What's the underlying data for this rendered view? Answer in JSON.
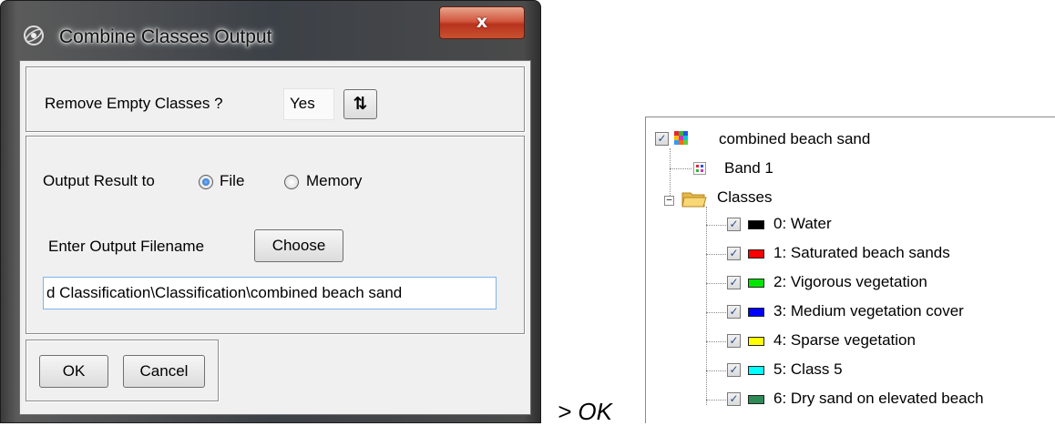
{
  "dialog": {
    "title": "Combine Classes Output",
    "close_label": "x",
    "remove_empty_label": "Remove Empty Classes ?",
    "remove_empty_value": "Yes",
    "output_label": "Output Result to",
    "radio_file_label": "File",
    "radio_memory_label": "Memory",
    "selected_output": "File",
    "filename_label": "Enter Output Filename",
    "choose_label": "Choose",
    "filename_value": "d Classification\\Classification\\combined beach sand",
    "ok_label": "OK",
    "cancel_label": "Cancel"
  },
  "caption": "> OK",
  "tree": {
    "layer_name": "combined beach sand",
    "band_label": "Band 1",
    "classes_folder": "Classes",
    "classes": [
      {
        "label": "0: Water",
        "color": "#000000",
        "checked": true
      },
      {
        "label": "1: Saturated beach sands",
        "color": "#ff0000",
        "checked": true
      },
      {
        "label": "2: Vigorous vegetation",
        "color": "#00e600",
        "checked": true
      },
      {
        "label": "3: Medium vegetation cover",
        "color": "#0000ff",
        "checked": true
      },
      {
        "label": "4: Sparse vegetation",
        "color": "#ffff00",
        "checked": true
      },
      {
        "label": "5: Class 5",
        "color": "#00ffff",
        "checked": true
      },
      {
        "label": "6: Dry sand on elevated beach",
        "color": "#2e8b57",
        "checked": true
      }
    ]
  },
  "colors": {
    "close_button": "#c9502f",
    "input_focus_border": "#7eb4ea"
  }
}
